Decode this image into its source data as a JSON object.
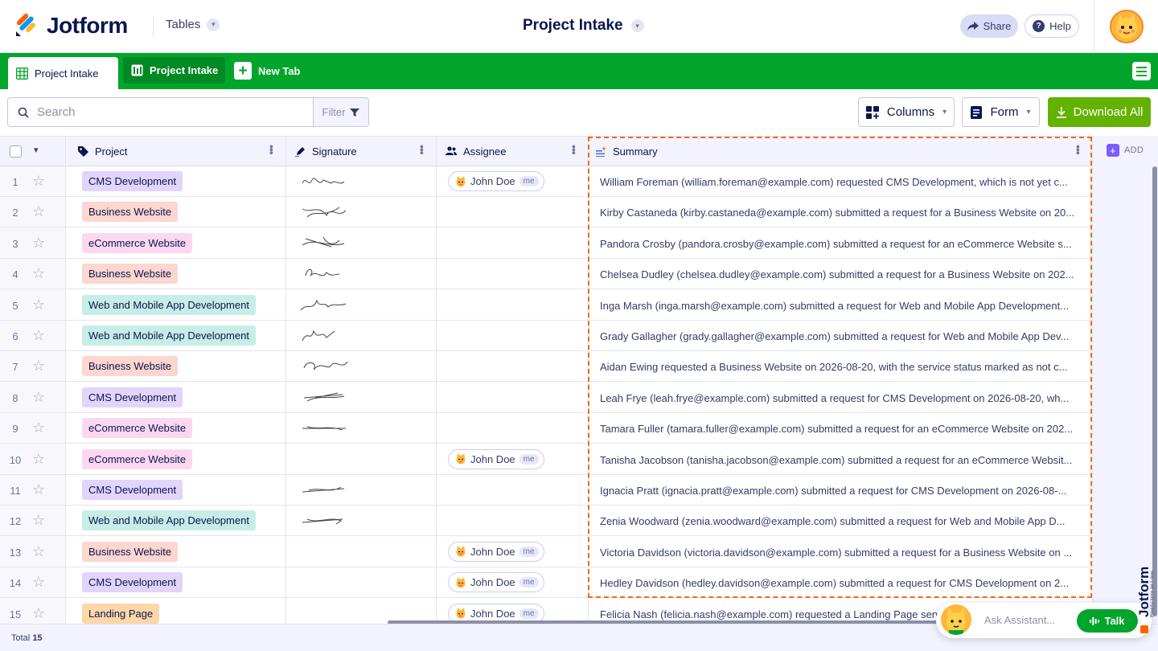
{
  "app": {
    "brand": "Jotform",
    "tables_label": "Tables",
    "title": "Project Intake"
  },
  "header": {
    "share_label": "Share",
    "help_label": "Help"
  },
  "tabs": [
    {
      "label": "Project Intake",
      "active": true
    },
    {
      "label": "Project Intake",
      "active": false
    },
    {
      "label": "New Tab"
    }
  ],
  "toolbar": {
    "search_placeholder": "Search",
    "filter_label": "Filter",
    "columns_label": "Columns",
    "form_label": "Form",
    "download_label": "Download All"
  },
  "columns": {
    "project": "Project",
    "signature": "Signature",
    "assignee": "Assignee",
    "summary": "Summary",
    "add": "ADD"
  },
  "colors": {
    "brand_green": "#01a52b",
    "download_green": "#64b200",
    "selection_orange": "#f26a1b"
  },
  "rows": [
    {
      "n": "1",
      "project": "CMS Development",
      "tag_color": "#e2d4fb",
      "signature": true,
      "assignee": "John Doe",
      "me": "me",
      "summary": "William Foreman (william.foreman@example.com) requested CMS Development, which is not yet c..."
    },
    {
      "n": "2",
      "project": "Business Website",
      "tag_color": "#fcd6cf",
      "signature": true,
      "assignee": "",
      "me": "",
      "summary": "Kirby Castaneda (kirby.castaneda@example.com) submitted a request for a Business Website on 20..."
    },
    {
      "n": "3",
      "project": "eCommerce Website",
      "tag_color": "#fcd8f0",
      "signature": true,
      "assignee": "",
      "me": "",
      "summary": "Pandora Crosby (pandora.crosby@example.com) submitted a request for an eCommerce Website s..."
    },
    {
      "n": "4",
      "project": "Business Website",
      "tag_color": "#fcd6cf",
      "signature": true,
      "assignee": "",
      "me": "",
      "summary": "Chelsea Dudley (chelsea.dudley@example.com) submitted a request for a Business Website on 202..."
    },
    {
      "n": "5",
      "project": "Web and Mobile App Development",
      "tag_color": "#c6eee6",
      "signature": true,
      "assignee": "",
      "me": "",
      "summary": "Inga Marsh (inga.marsh@example.com) submitted a request for Web and Mobile App Development..."
    },
    {
      "n": "6",
      "project": "Web and Mobile App Development",
      "tag_color": "#c6eee6",
      "signature": true,
      "assignee": "",
      "me": "",
      "summary": "Grady Gallagher (grady.gallagher@example.com) submitted a request for Web and Mobile App Dev..."
    },
    {
      "n": "7",
      "project": "Business Website",
      "tag_color": "#fcd6cf",
      "signature": true,
      "assignee": "",
      "me": "",
      "summary": "Aidan Ewing requested a Business Website on 2026-08-20, with the service status marked as not c..."
    },
    {
      "n": "8",
      "project": "CMS Development",
      "tag_color": "#e2d4fb",
      "signature": true,
      "assignee": "",
      "me": "",
      "summary": "Leah Frye (leah.frye@example.com) submitted a request for CMS Development on 2026-08-20, wh..."
    },
    {
      "n": "9",
      "project": "eCommerce Website",
      "tag_color": "#fcd8f0",
      "signature": true,
      "assignee": "",
      "me": "",
      "summary": "Tamara Fuller (tamara.fuller@example.com) submitted a request for an eCommerce Website on 202..."
    },
    {
      "n": "10",
      "project": "eCommerce Website",
      "tag_color": "#fcd8f0",
      "signature": false,
      "assignee": "John Doe",
      "me": "me",
      "summary": "Tanisha Jacobson (tanisha.jacobson@example.com) submitted a request for an eCommerce Websit..."
    },
    {
      "n": "11",
      "project": "CMS Development",
      "tag_color": "#e2d4fb",
      "signature": true,
      "assignee": "",
      "me": "",
      "summary": "Ignacia Pratt (ignacia.pratt@example.com) submitted a request for CMS Development on 2026-08-..."
    },
    {
      "n": "12",
      "project": "Web and Mobile App Development",
      "tag_color": "#c6eee6",
      "signature": true,
      "assignee": "",
      "me": "",
      "summary": "Zenia Woodward (zenia.woodward@example.com) submitted a request for Web and Mobile App D..."
    },
    {
      "n": "13",
      "project": "Business Website",
      "tag_color": "#fcd6cf",
      "signature": false,
      "assignee": "John Doe",
      "me": "me",
      "summary": "Victoria Davidson (victoria.davidson@example.com) submitted a request for a Business Website on ..."
    },
    {
      "n": "14",
      "project": "CMS Development",
      "tag_color": "#e2d4fb",
      "signature": false,
      "assignee": "John Doe",
      "me": "me",
      "summary": "Hedley Davidson (hedley.davidson@example.com) submitted a request for CMS Development on 2..."
    },
    {
      "n": "15",
      "project": "Landing Page",
      "tag_color": "#fdd7a8",
      "signature": false,
      "assignee": "John Doe",
      "me": "me",
      "summary": "Felicia Nash (felicia.nash@example.com) requested a Landing Page serv"
    }
  ],
  "footer": {
    "total_label": "Total",
    "total_count": "15"
  },
  "assistant": {
    "placeholder": "Ask Assistant...",
    "talk_label": "Talk"
  },
  "watermark": {
    "brand": "Jotform",
    "tagline": "Powerful forms get it done."
  }
}
